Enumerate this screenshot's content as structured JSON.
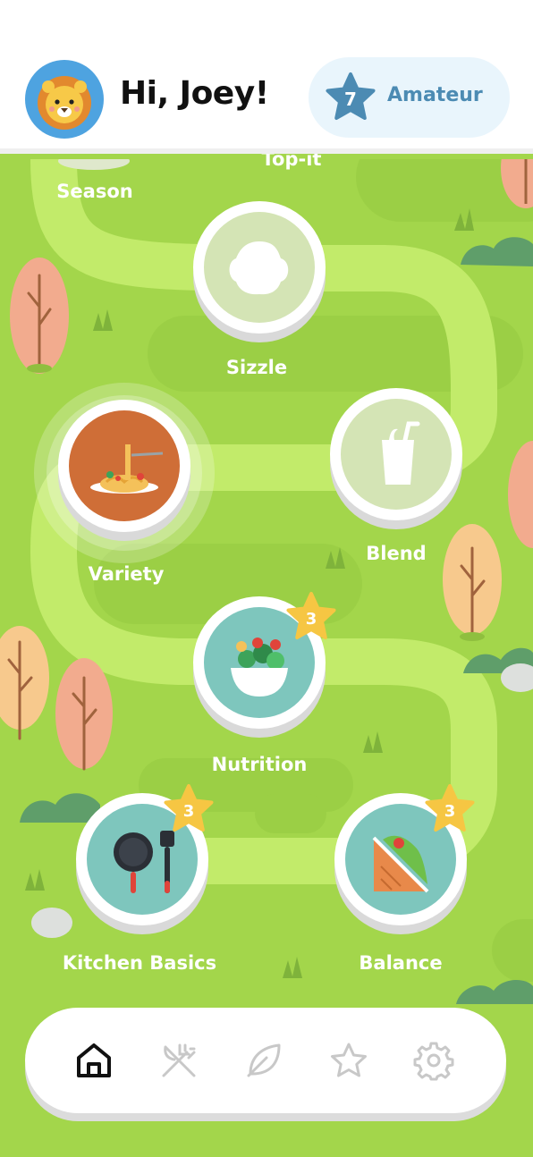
{
  "header": {
    "greeting": "Hi, Joey!",
    "avatar_icon": "lion-icon",
    "level": {
      "number": "7",
      "title": "Amateur",
      "icon": "star-icon"
    }
  },
  "colors": {
    "grass": "#a3d64b",
    "path": "#c2eb6a",
    "teal": "#7ec6bd",
    "locked": "#d4e4b5",
    "active": "#cf6e37",
    "badge": "#f6c643",
    "level_text": "#4c8bb3"
  },
  "map": {
    "partial_labels": {
      "season": "Season",
      "top_it": "Top-it"
    },
    "lessons": [
      {
        "id": "sizzle",
        "label": "Sizzle",
        "state": "locked",
        "icon": "sizzle-icon"
      },
      {
        "id": "variety",
        "label": "Variety",
        "state": "active",
        "icon": "pasta-icon"
      },
      {
        "id": "blend",
        "label": "Blend",
        "state": "locked",
        "icon": "smoothie-cup-icon"
      },
      {
        "id": "nutrition",
        "label": "Nutrition",
        "state": "completed",
        "icon": "salad-bowl-icon",
        "stars": "3"
      },
      {
        "id": "kitchen-basics",
        "label": "Kitchen Basics",
        "state": "completed",
        "icon": "pan-spatula-icon",
        "stars": "3"
      },
      {
        "id": "balance",
        "label": "Balance",
        "state": "completed",
        "icon": "sandwich-icon",
        "stars": "3"
      }
    ]
  },
  "nav": {
    "items": [
      {
        "id": "home",
        "icon": "home-icon",
        "active": true
      },
      {
        "id": "recipes",
        "icon": "fork-knife-icon",
        "active": false
      },
      {
        "id": "nature",
        "icon": "leaf-icon",
        "active": false
      },
      {
        "id": "favorites",
        "icon": "star-icon",
        "active": false
      },
      {
        "id": "settings",
        "icon": "gear-icon",
        "active": false
      }
    ]
  }
}
